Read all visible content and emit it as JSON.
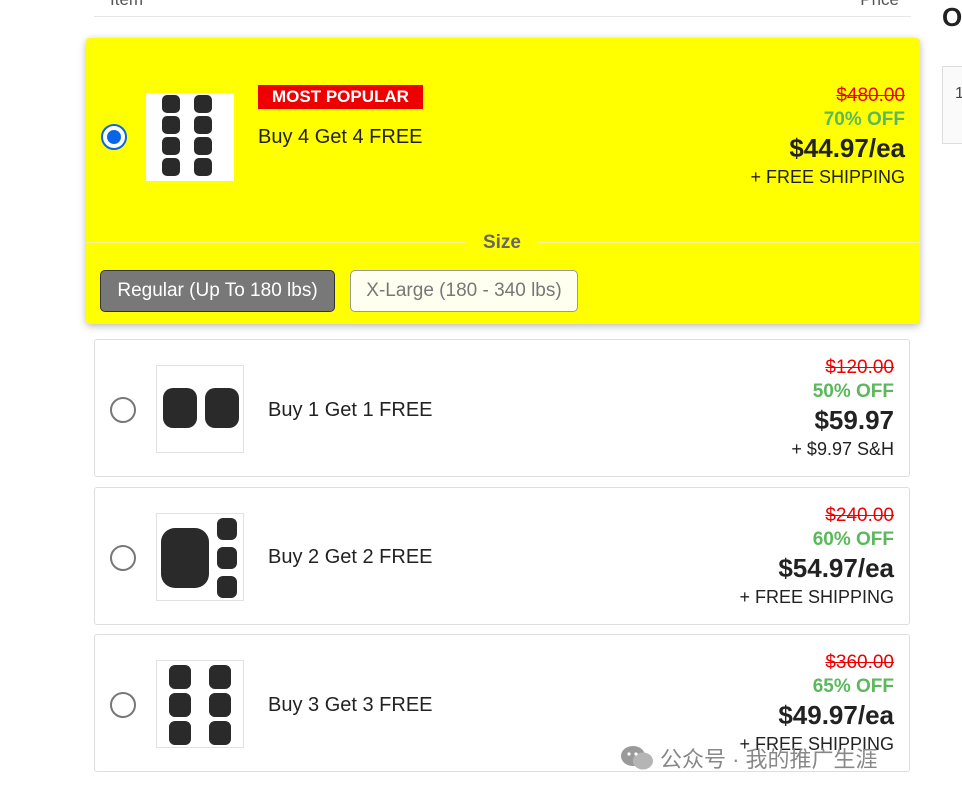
{
  "table_header": {
    "item": "Item",
    "price": "Price"
  },
  "sidebar": {
    "heading_initial": "O"
  },
  "offers": [
    {
      "label": "Buy 4 Get 4 FREE",
      "badge": "MOST POPULAR",
      "selected": true,
      "original_price": "$480.00",
      "discount": "70% OFF",
      "price": "$44.97/ea",
      "shipping": "+ FREE SHIPPING",
      "image": "8-knee-braces-thumbnail"
    },
    {
      "label": "Buy 1 Get 1 FREE",
      "selected": false,
      "original_price": "$120.00",
      "discount": "50% OFF",
      "price": "$59.97",
      "shipping": "+ $9.97 S&H",
      "image": "2-knee-braces-thumbnail"
    },
    {
      "label": "Buy 2 Get 2 FREE",
      "selected": false,
      "original_price": "$240.00",
      "discount": "60% OFF",
      "price": "$54.97/ea",
      "shipping": "+ FREE SHIPPING",
      "image": "4-knee-braces-thumbnail"
    },
    {
      "label": "Buy 3 Get 3 FREE",
      "selected": false,
      "original_price": "$360.00",
      "discount": "65% OFF",
      "price": "$49.97/ea",
      "shipping": "+ FREE SHIPPING",
      "image": "6-knee-braces-thumbnail"
    }
  ],
  "size": {
    "heading": "Size",
    "options": [
      "Regular (Up To 180 lbs)",
      "X-Large (180 - 340 lbs)"
    ],
    "selected": "Regular (Up To 180 lbs)"
  },
  "watermark": "公众号 · 我的推广生涯",
  "colors": {
    "featured_bg": "#ffff00",
    "badge_bg": "#ee0000",
    "old_price": "#ee0000",
    "discount": "#5cb85c",
    "radio_selected": "#0a66e8",
    "size_active_bg": "#787878"
  }
}
